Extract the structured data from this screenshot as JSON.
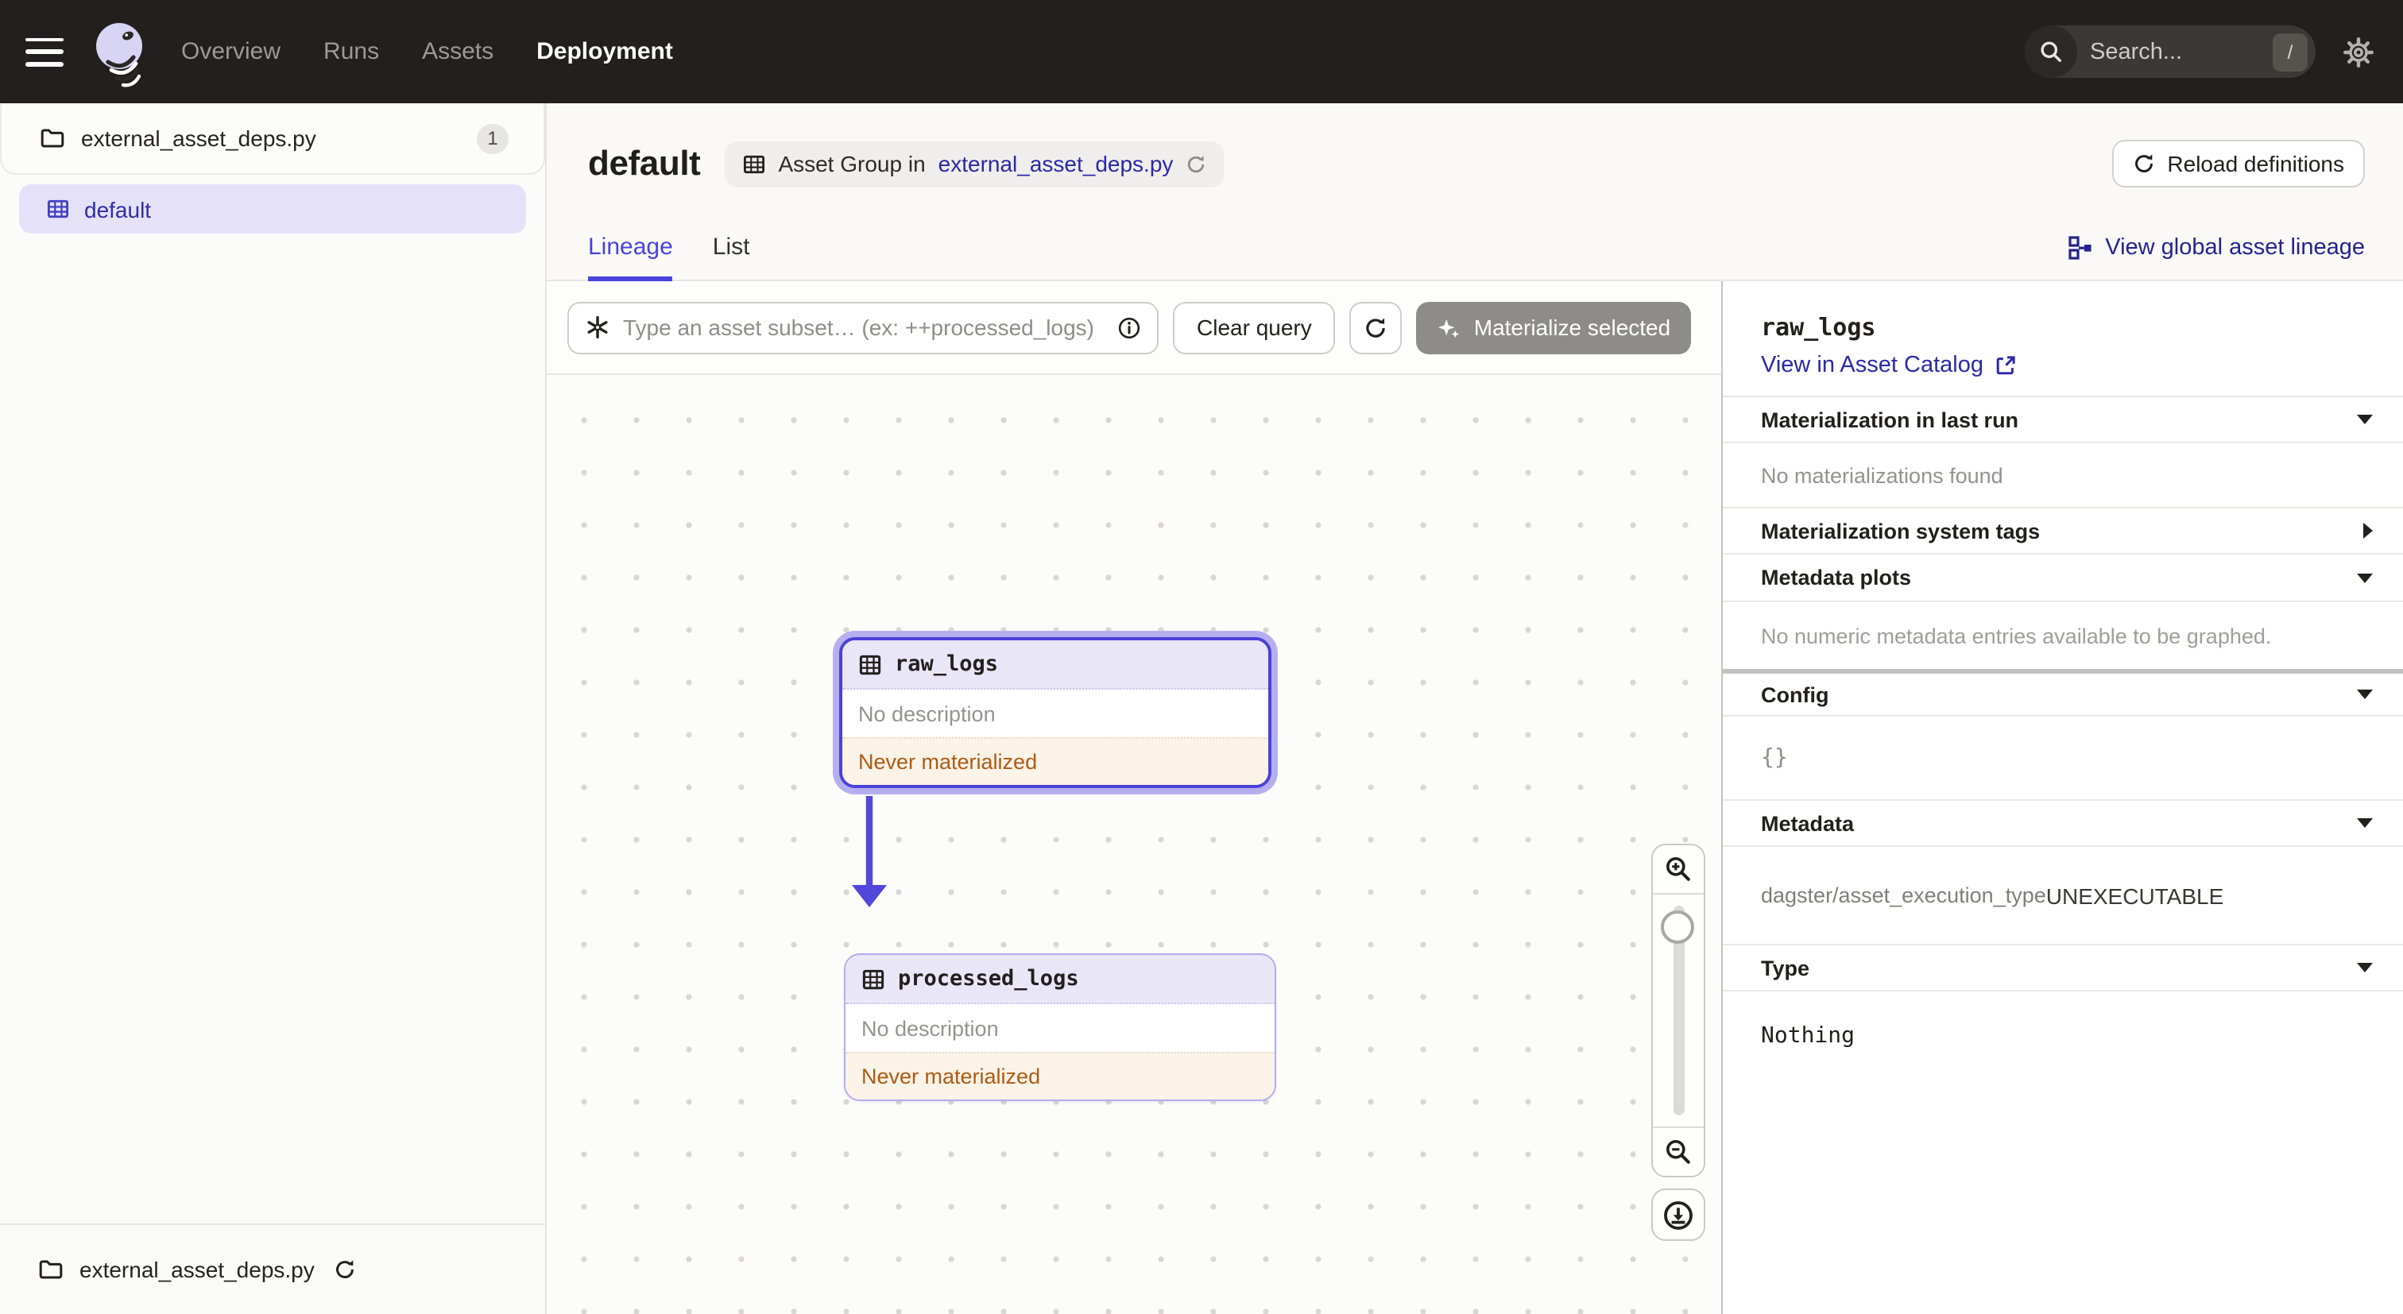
{
  "topbar": {
    "nav": [
      {
        "label": "Overview",
        "active": false
      },
      {
        "label": "Runs",
        "active": false
      },
      {
        "label": "Assets",
        "active": false
      },
      {
        "label": "Deployment",
        "active": true
      }
    ],
    "search_placeholder": "Search...",
    "search_shortcut": "/"
  },
  "sidebar": {
    "repo": {
      "name": "external_asset_deps.py",
      "badge": "1"
    },
    "group": {
      "label": "default",
      "selected": true
    },
    "footer": {
      "name": "external_asset_deps.py"
    }
  },
  "header": {
    "title": "default",
    "tag_prefix": "Asset Group in",
    "tag_link": "external_asset_deps.py",
    "reload_label": "Reload definitions"
  },
  "tabs": {
    "items": [
      {
        "label": "Lineage",
        "active": true
      },
      {
        "label": "List",
        "active": false
      }
    ],
    "global_lineage_label": "View global asset lineage"
  },
  "toolbar": {
    "filter_placeholder": "Type an asset subset… (ex: ++processed_logs)",
    "clear_label": "Clear query",
    "materialize_label": "Materialize selected"
  },
  "graph": {
    "nodes": [
      {
        "label": "raw_logs",
        "description": "No description",
        "status": "Never materialized",
        "selected": true
      },
      {
        "label": "processed_logs",
        "description": "No description",
        "status": "Never materialized",
        "selected": false
      }
    ],
    "edge": {
      "from": "raw_logs",
      "to": "processed_logs"
    },
    "accent_color": "#4A42D6"
  },
  "panel": {
    "title": "raw_logs",
    "catalog_link": "View in Asset Catalog",
    "sections": [
      {
        "label": "Materialization in last run",
        "state": "expanded",
        "body": "No materializations found"
      },
      {
        "label": "Materialization system tags",
        "state": "collapsed",
        "body": ""
      },
      {
        "label": "Metadata plots",
        "state": "expanded",
        "body": "No numeric metadata entries available to be graphed."
      },
      {
        "label": "Config",
        "state": "expanded",
        "body": "{}"
      },
      {
        "label": "Metadata",
        "state": "expanded",
        "key": "dagster/asset_execution_type",
        "value": "UNEXECUTABLE"
      },
      {
        "label": "Type",
        "state": "expanded",
        "body": "Nothing"
      }
    ]
  }
}
